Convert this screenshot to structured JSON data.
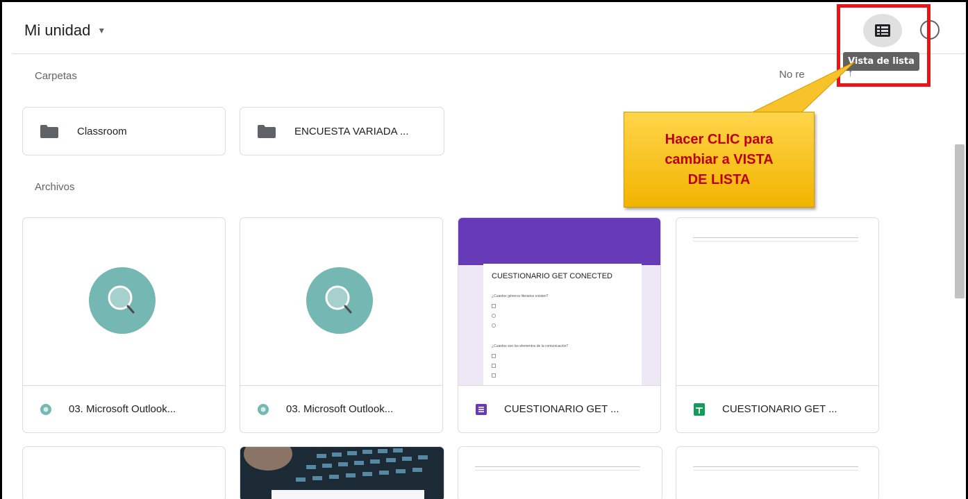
{
  "header": {
    "title": "Mi unidad",
    "view_tooltip": "Vista de lista",
    "info_icon": "info-icon",
    "view_icon": "list-view-icon"
  },
  "sections": {
    "folders_label": "Carpetas",
    "files_label": "Archivos",
    "sort_label": "No      re",
    "sort_arrow": "↑"
  },
  "folders": [
    {
      "name": "Classroom",
      "icon": "folder-icon"
    },
    {
      "name": "ENCUESTA VARIADA ...",
      "icon": "folder-icon"
    }
  ],
  "files": [
    {
      "name": "03. Microsoft Outlook...",
      "icon": "generic-file-icon",
      "preview": "search-circle"
    },
    {
      "name": "03. Microsoft Outlook...",
      "icon": "generic-file-icon",
      "preview": "search-circle"
    },
    {
      "name": "CUESTIONARIO GET ...",
      "icon": "forms-icon",
      "preview": "form"
    },
    {
      "name": "CUESTIONARIO GET ...",
      "icon": "sheets-icon",
      "preview": "sheet"
    }
  ],
  "form_preview": {
    "title": "CUESTIONARIO GET CONECTED",
    "question1": "¿Cuantos géneros literarios existen?",
    "question2": "¿Cuantos son los elementos de la comunicación?"
  },
  "callout": {
    "line1": "Hacer CLIC para",
    "line2": "cambiar a VISTA",
    "line3": "DE LISTA"
  },
  "colors": {
    "accent_red": "#e8141a",
    "callout_text": "#c00000",
    "callout_bg": "#f5bd12",
    "forms_purple": "#673ab7",
    "sheets_green": "#0f9d58",
    "teal": "#75b7b3"
  }
}
